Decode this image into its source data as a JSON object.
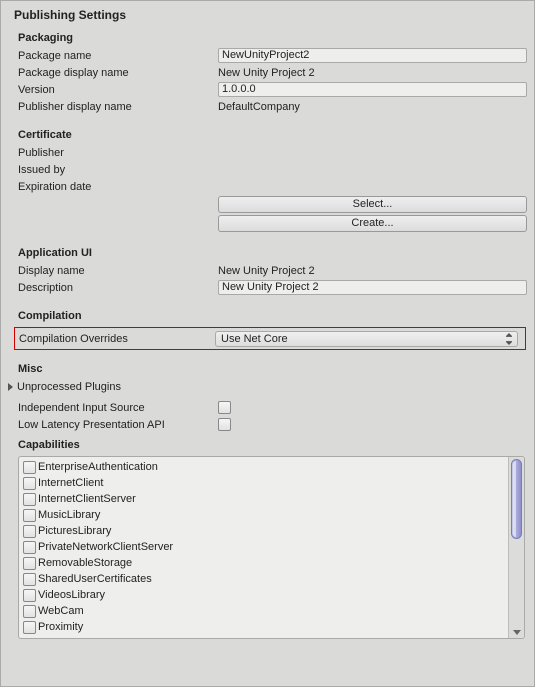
{
  "title": "Publishing Settings",
  "packaging": {
    "heading": "Packaging",
    "package_name_label": "Package name",
    "package_name": "NewUnityProject2",
    "package_display_name_label": "Package display name",
    "package_display_name": "New Unity Project 2",
    "version_label": "Version",
    "version": "1.0.0.0",
    "publisher_display_name_label": "Publisher display name",
    "publisher_display_name": "DefaultCompany"
  },
  "certificate": {
    "heading": "Certificate",
    "publisher_label": "Publisher",
    "issued_by_label": "Issued by",
    "expiration_label": "Expiration date",
    "select_btn": "Select...",
    "create_btn": "Create..."
  },
  "app_ui": {
    "heading": "Application UI",
    "display_name_label": "Display name",
    "display_name": "New Unity Project 2",
    "description_label": "Description",
    "description": "New Unity Project 2"
  },
  "compilation": {
    "heading": "Compilation",
    "overrides_label": "Compilation Overrides",
    "overrides_value": "Use Net Core"
  },
  "misc": {
    "heading": "Misc",
    "unprocessed_plugins": "Unprocessed Plugins",
    "independent_input_label": "Independent Input Source",
    "low_latency_label": "Low Latency Presentation API"
  },
  "capabilities": {
    "heading": "Capabilities",
    "items": [
      "EnterpriseAuthentication",
      "InternetClient",
      "InternetClientServer",
      "MusicLibrary",
      "PicturesLibrary",
      "PrivateNetworkClientServer",
      "RemovableStorage",
      "SharedUserCertificates",
      "VideosLibrary",
      "WebCam",
      "Proximity"
    ]
  }
}
